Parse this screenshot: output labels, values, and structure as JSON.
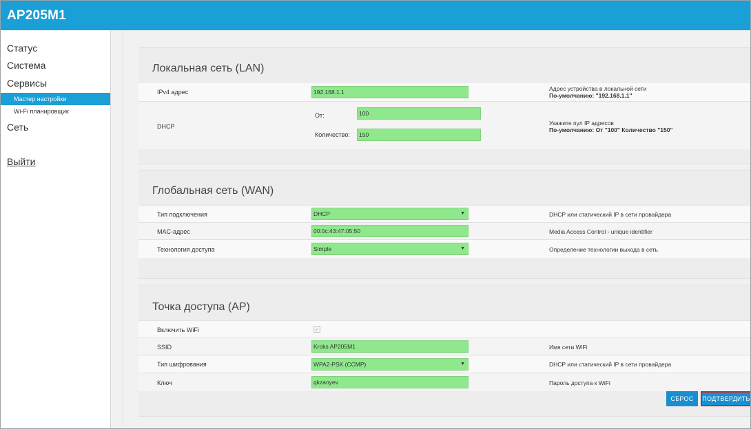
{
  "header": {
    "title": "AP205M1"
  },
  "sidebar": {
    "items": [
      {
        "label": "Статус"
      },
      {
        "label": "Система"
      },
      {
        "label": "Сервисы"
      },
      {
        "label": "Мастер настройки"
      },
      {
        "label": "Wi-Fi планировщик"
      },
      {
        "label": "Сеть"
      }
    ],
    "logout": "Выйти"
  },
  "lan": {
    "title": "Локальная сеть (LAN)",
    "ipv4_label": "IPv4 адрес",
    "ipv4_value": "192.168.1.1",
    "ipv4_help_1": "Адрес устройства в локальной сети",
    "ipv4_help_2": "По-умолчанию: \"192.168.1.1\"",
    "dhcp_label": "DHCP",
    "from_label": "От:",
    "from_value": "100",
    "count_label": "Количество:",
    "count_value": "150",
    "dhcp_help_1": "Укажите пул IP адресов",
    "dhcp_help_2": "По-умолчанию: От \"100\" Количество \"150\""
  },
  "wan": {
    "title": "Глобальная сеть (WAN)",
    "conn_label": "Тип подключения",
    "conn_value": "DHCP",
    "conn_help": "DHCP или статический IP в сети провайдера",
    "mac_label": "MAC-адрес",
    "mac_value": "00:0c:43:47:05:50",
    "mac_help": "Media Access Control - unique identifier",
    "tech_label": "Технология доступа",
    "tech_value": "Simple",
    "tech_help": "Определение технологии выхода в сеть"
  },
  "ap": {
    "title": "Точка доступа (AP)",
    "wifi_label": "Включить WiFi",
    "ssid_label": "SSID",
    "ssid_value": "Kroks AP205M1",
    "ssid_help": "Имя сети WiFi",
    "enc_label": "Тип шифрования",
    "enc_value": "WPA2-PSK (CCMP)",
    "enc_help": "DHCP или статический IP в сети провайдера",
    "key_label": "Ключ",
    "key_value": "qkzanyev",
    "key_help": "Пароль доступа к WiFi"
  },
  "buttons": {
    "reset": "СБРОС",
    "confirm": "ПОДТВЕРДИТЬ"
  }
}
